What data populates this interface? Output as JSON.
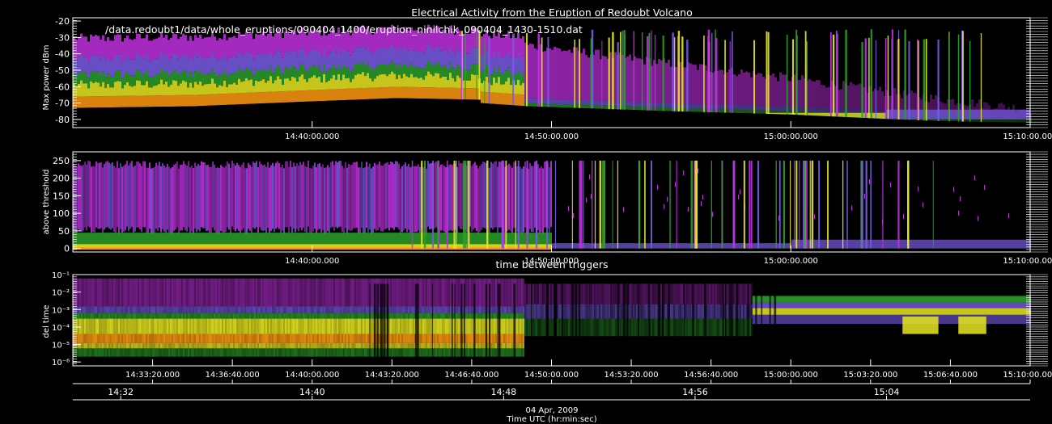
{
  "title": "Electrical Activity from the Eruption of Redoubt Volcano",
  "file_path": "/data.redoubt1/data/whole_eruptions/090404_1400/eruption_ninilchik_090404_1430-1510.dat",
  "date_label": "04 Apr, 2009",
  "xlabel": "Time UTC (hr:min:sec)",
  "colors": {
    "magenta": "#c030e0",
    "purple": "#7a5ce8",
    "green": "#2aa02a",
    "yellow": "#e8e820",
    "orange": "#ff9a10",
    "red": "#ff4010"
  },
  "chart_data": [
    {
      "type": "heatmap",
      "panel": "max-power",
      "title": "",
      "ylabel": "Max power dBm",
      "ylim": [
        -85,
        -18
      ],
      "yticks": [
        -20,
        -30,
        -40,
        -50,
        -60,
        -70,
        -80
      ],
      "ytick_labels": [
        "-20",
        "-30",
        "-40",
        "-50",
        "-60",
        "-70",
        "-80"
      ],
      "xlim": [
        "14:30:00",
        "15:10:00"
      ],
      "xticks": [
        "14:40:00",
        "14:50:00",
        "15:00:00",
        "15:10:00"
      ],
      "xtick_labels": [
        "14:40:00.000",
        "14:50:00.000",
        "15:00:00.000",
        "15:10:00.000"
      ],
      "noise_floor": {
        "x": [
          "14:30:00",
          "14:35:00",
          "14:40:00",
          "14:43:30",
          "14:47:00",
          "14:47:00",
          "14:49:00",
          "14:55:00",
          "15:00:00",
          "15:06:00",
          "15:10:00"
        ],
        "y": [
          -73,
          -72,
          -69,
          -67,
          -68,
          -70,
          -72,
          -75,
          -77,
          -81,
          -82
        ]
      }
    },
    {
      "type": "heatmap",
      "panel": "above-threshold",
      "title": "",
      "ylabel": "above threshold",
      "ylim": [
        -10,
        275
      ],
      "yticks": [
        0,
        50,
        100,
        150,
        200,
        250
      ],
      "ytick_labels": [
        "0",
        "50",
        "100",
        "150",
        "200",
        "250"
      ],
      "xlim": [
        "14:30:00",
        "15:10:00"
      ],
      "xticks": [
        "14:40:00",
        "14:50:00",
        "15:00:00",
        "15:10:00"
      ],
      "xtick_labels": [
        "14:40:00.000",
        "14:50:00.000",
        "15:00:00.000",
        "15:10:00.000"
      ]
    },
    {
      "type": "heatmap",
      "panel": "del-time",
      "title": "time between triggers",
      "ylabel": "del time",
      "yscale": "log",
      "ylim": [
        6e-07,
        0.1
      ],
      "yticks": [
        0.1,
        0.01,
        0.001,
        0.0001,
        1e-05,
        1e-06
      ],
      "ytick_labels": [
        "10⁻¹",
        "10⁻²",
        "10⁻³",
        "10⁻⁴",
        "10⁻⁵",
        "10⁻⁶"
      ],
      "xlim": [
        "14:30:00",
        "15:10:00"
      ],
      "xticks": [
        "14:33:20",
        "14:36:40",
        "14:40:00",
        "14:43:20",
        "14:46:40",
        "14:50:00",
        "14:53:20",
        "14:56:40",
        "15:00:00",
        "15:03:20",
        "15:06:40",
        "15:10:00"
      ],
      "xtick_labels": [
        "14:33:20.000",
        "14:36:40.000",
        "14:40:00.000",
        "14:43:20.000",
        "14:46:40.000",
        "14:50:00.000",
        "14:53:20.000",
        "14:56:40.000",
        "15:00:00.000",
        "15:03:20.000",
        "15:06:40.000",
        "15:10:00.000"
      ],
      "secondary_xticks": [
        "14:32",
        "14:40",
        "14:48",
        "14:56",
        "15:04"
      ],
      "secondary_xtick_labels": [
        "14:32",
        "14:40",
        "14:48",
        "14:56",
        "15:04"
      ]
    }
  ]
}
